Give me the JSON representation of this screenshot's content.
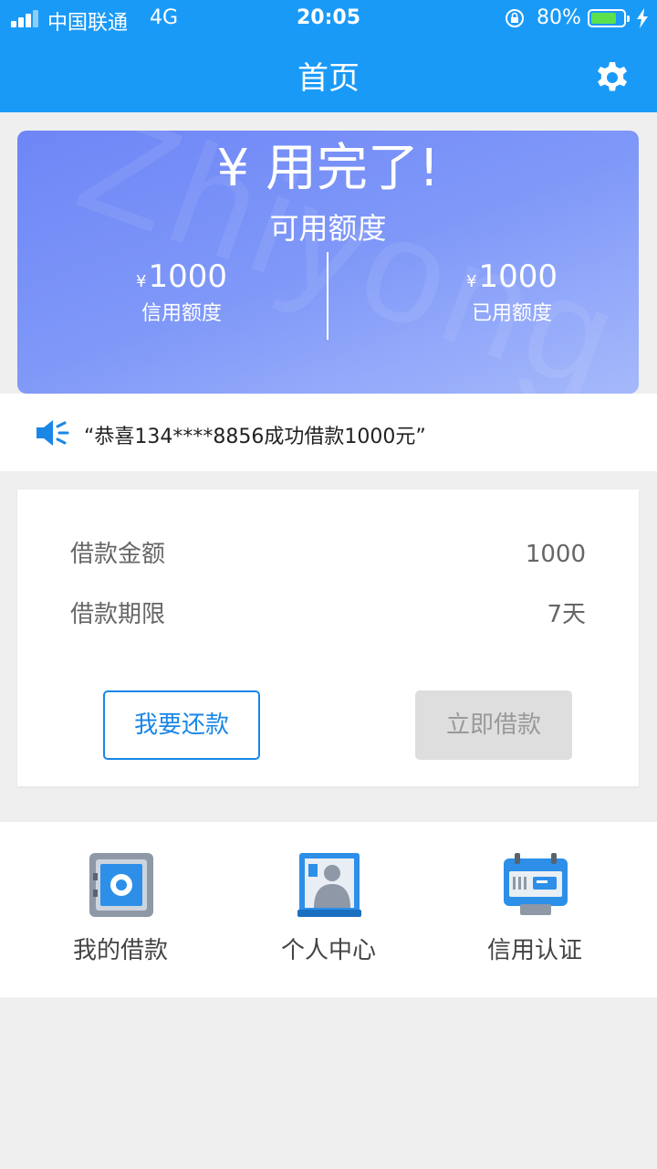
{
  "status_bar": {
    "carrier": "中国联通",
    "network": "4G",
    "time": "20:05",
    "battery": "80%",
    "battery_level": 0.8
  },
  "header": {
    "title": "首页",
    "settings_icon": "gear-icon"
  },
  "credit_card": {
    "headline": "¥ 用完了!",
    "subtitle": "可用额度",
    "watermark": "Zhiyong",
    "credit_limit": {
      "currency": "¥",
      "value": "1000",
      "label": "信用额度"
    },
    "used_limit": {
      "currency": "¥",
      "value": "1000",
      "label": "已用额度"
    }
  },
  "notice": {
    "icon": "speaker-icon",
    "text": "“恭喜134****8856成功借款1000元”"
  },
  "loan": {
    "amount_label": "借款金额",
    "amount_value": "1000",
    "term_label": "借款期限",
    "term_value": "7天",
    "repay_button": "我要还款",
    "borrow_button": "立即借款"
  },
  "menu": [
    {
      "label": "我的借款",
      "icon": "safe-icon"
    },
    {
      "label": "个人中心",
      "icon": "person-icon"
    },
    {
      "label": "信用认证",
      "icon": "id-card-icon"
    }
  ],
  "colors": {
    "header": "#1a9af7",
    "card_gradient_start": "#6e86f6",
    "card_gradient_end": "#a6b9fb",
    "accent": "#1a87e6",
    "disabled_button": "#dedede"
  }
}
